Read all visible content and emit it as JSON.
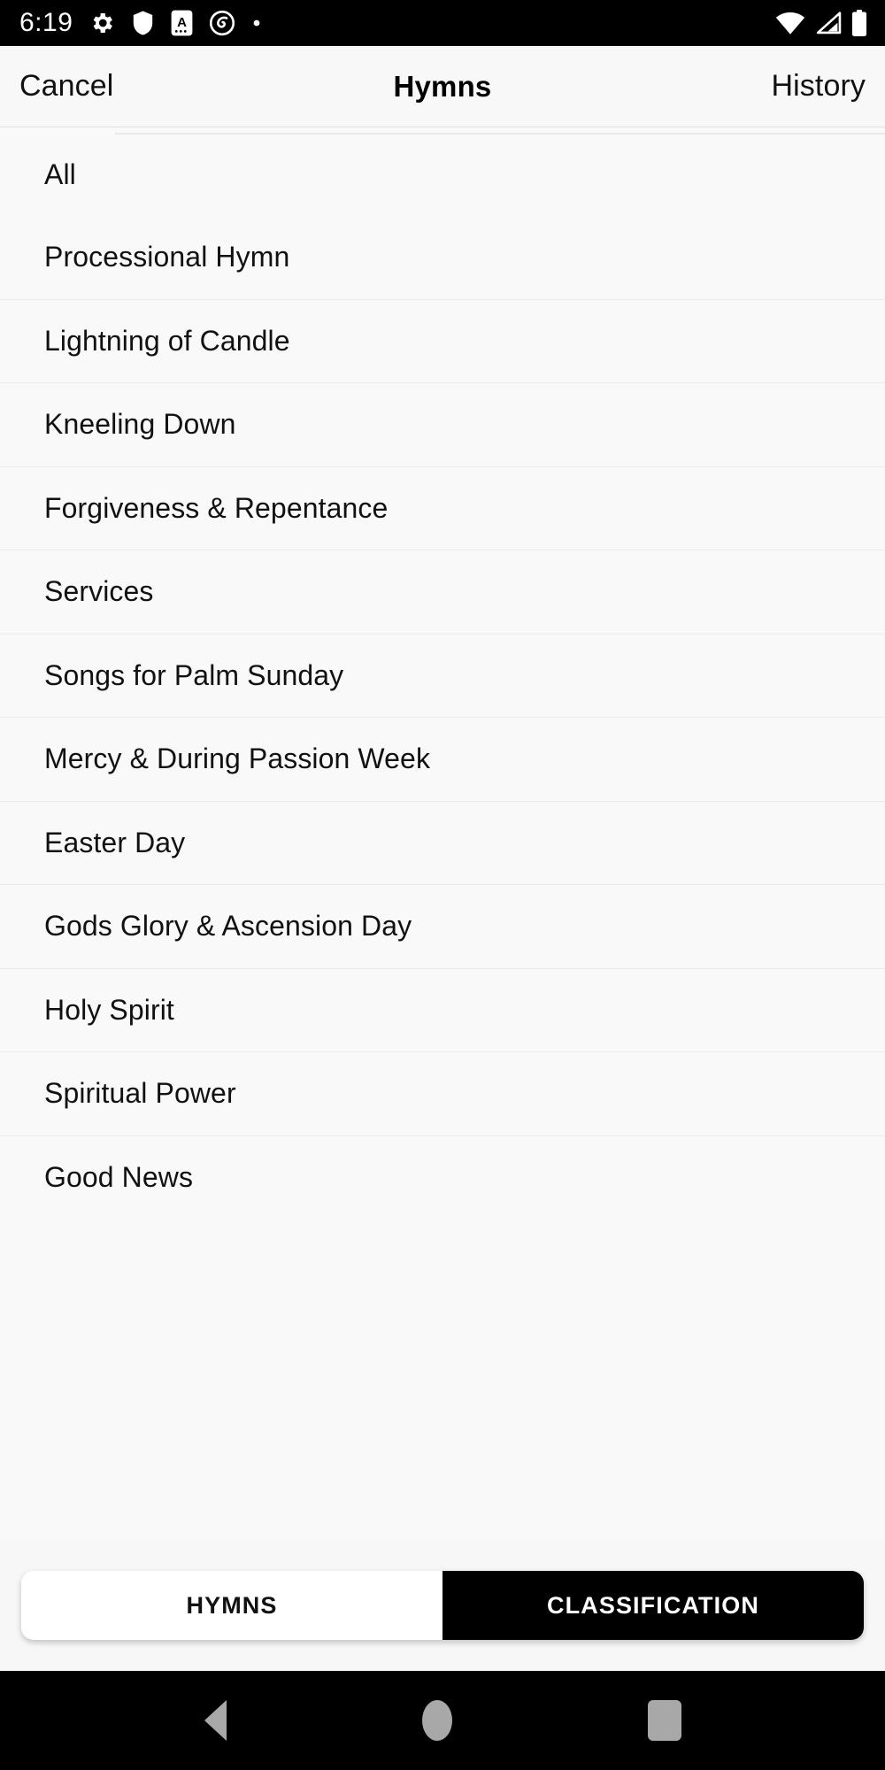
{
  "statusbar": {
    "time": "6:19",
    "left_icons": [
      "gear-icon",
      "shield-icon",
      "a-badge-icon",
      "circle-logo-icon",
      "dot-icon"
    ],
    "right_icons": [
      "wifi-icon",
      "cellular-signal-icon",
      "battery-icon"
    ]
  },
  "header": {
    "cancel_label": "Cancel",
    "title": "Hymns",
    "history_label": "History"
  },
  "list": {
    "items": [
      {
        "label": "All"
      },
      {
        "label": "Processional Hymn"
      },
      {
        "label": "Lightning of Candle"
      },
      {
        "label": "Kneeling Down"
      },
      {
        "label": "Forgiveness & Repentance"
      },
      {
        "label": "Services"
      },
      {
        "label": "Songs for Palm Sunday"
      },
      {
        "label": "Mercy & During Passion Week"
      },
      {
        "label": "Easter Day"
      },
      {
        "label": "Gods Glory & Ascension Day"
      },
      {
        "label": "Holy Spirit"
      },
      {
        "label": "Spiritual Power"
      },
      {
        "label": "Good News"
      }
    ]
  },
  "tabbar": {
    "tabs": [
      {
        "label": "HYMNS",
        "active": false
      },
      {
        "label": "CLASSIFICATION",
        "active": true
      }
    ],
    "active_bg": "#000000",
    "inactive_bg": "#ffffff"
  },
  "navbar": {
    "back": "back-triangle-icon",
    "home": "home-circle-icon",
    "recents": "recents-square-icon"
  }
}
